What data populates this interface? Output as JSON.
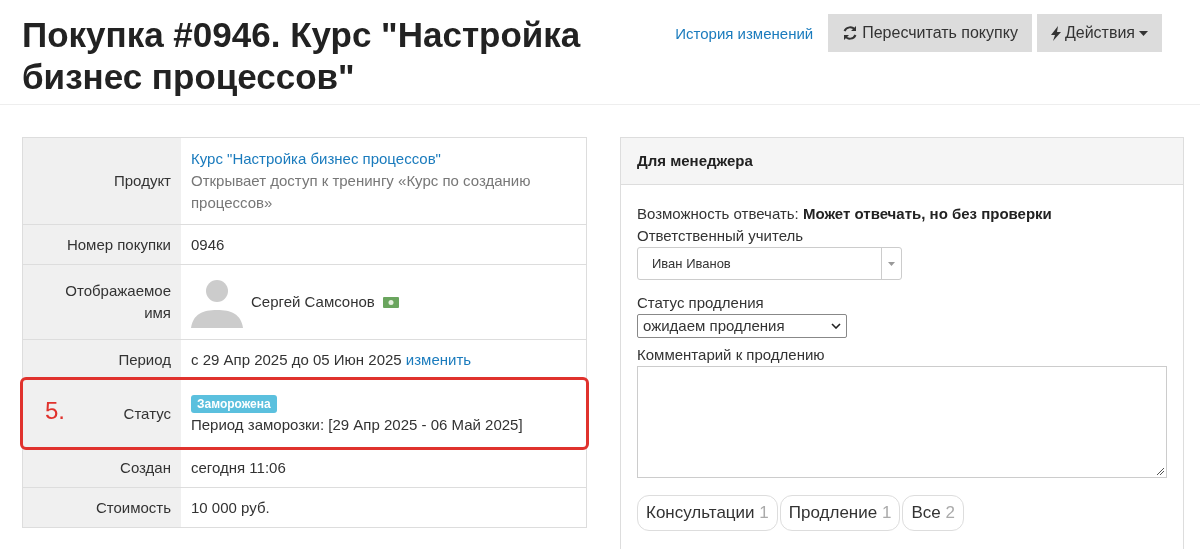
{
  "page_title": "Покупка #0946. Курс \"Настройка бизнес процессов\"",
  "header_actions": {
    "history_link": "История изменений",
    "recalc_button": "Пересчитать покупку",
    "actions_button": "Действия"
  },
  "details": [
    {
      "kind": "product",
      "label": "Продукт",
      "link": "Курс \"Настройка бизнес процессов\"",
      "description": "Открывает доступ к тренингу «Курс по созданию процессов»"
    },
    {
      "kind": "text",
      "label": "Номер покупки",
      "value": "0946"
    },
    {
      "kind": "user",
      "label": "Отображаемое имя",
      "value": "Сергей Самсонов"
    },
    {
      "kind": "period",
      "label": "Период",
      "value": "с 29 Апр 2025 до 05 Июн 2025",
      "link": "изменить"
    },
    {
      "kind": "status",
      "label": "Статус",
      "badge": "Заморожена",
      "value": "Период заморозки: [29 Апр 2025 - 06 Май 2025]",
      "annotation": "5."
    },
    {
      "kind": "text",
      "label": "Создан",
      "value": "сегодня 11:06"
    },
    {
      "kind": "text",
      "label": "Стоимость",
      "value": "10 000 руб."
    }
  ],
  "manager_panel": {
    "title": "Для менеджера",
    "reply_label": "Возможность отвечать:",
    "reply_value": "Может отвечать, но без проверки",
    "teacher_label": "Ответственный учитель",
    "teacher_value": "Иван Иванов",
    "renewal_label": "Статус продления",
    "renewal_value": "ожидаем продления",
    "comment_label": "Комментарий к продлению",
    "tabs": [
      {
        "label": "Консультации",
        "count": "1",
        "selected": false
      },
      {
        "label": "Продление",
        "count": "1",
        "selected": false
      },
      {
        "label": "Все",
        "count": "2",
        "selected": false
      }
    ]
  }
}
